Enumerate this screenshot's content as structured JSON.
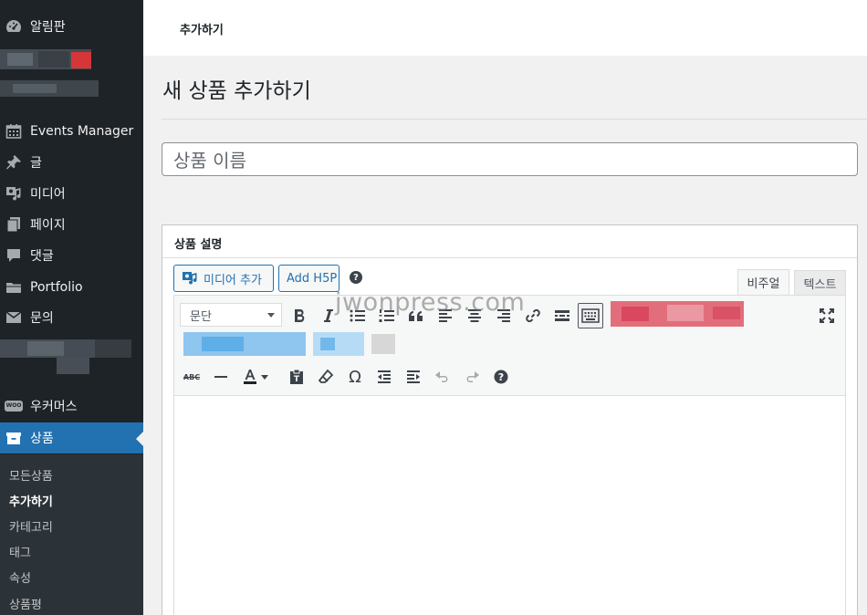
{
  "sidebar": {
    "items": [
      {
        "label": "알림판",
        "icon": "dashboard-icon"
      },
      {
        "label": "Events Manager",
        "icon": "calendar-icon"
      },
      {
        "label": "글",
        "icon": "pin-icon"
      },
      {
        "label": "미디어",
        "icon": "media-icon"
      },
      {
        "label": "페이지",
        "icon": "pages-icon"
      },
      {
        "label": "댓글",
        "icon": "comment-icon"
      },
      {
        "label": "Portfolio",
        "icon": "folder-icon"
      },
      {
        "label": "문의",
        "icon": "mail-icon"
      },
      {
        "label": "우커머스",
        "icon": "woo-icon",
        "icon_text": "WOO"
      },
      {
        "label": "상품",
        "icon": "archive-icon"
      }
    ],
    "submenu": [
      "모든상품",
      "추가하기",
      "카테고리",
      "태그",
      "속성",
      "상품평"
    ]
  },
  "topbar": {
    "crumb": "추가하기"
  },
  "main": {
    "title": "새 상품 추가하기",
    "title_placeholder": "상품 이름",
    "description_box": {
      "heading": "상품 설명",
      "add_media_label": "미디어 추가",
      "add_h5p_label": "Add H5P",
      "help_glyph": "?",
      "tabs": [
        "비주얼",
        "텍스트"
      ],
      "format_value": "문단"
    }
  },
  "watermark": "jwonpress.com",
  "colors": {
    "sidebar_bg": "#1d2327",
    "accent": "#2271b1",
    "submenu_bg": "#2c3338"
  }
}
